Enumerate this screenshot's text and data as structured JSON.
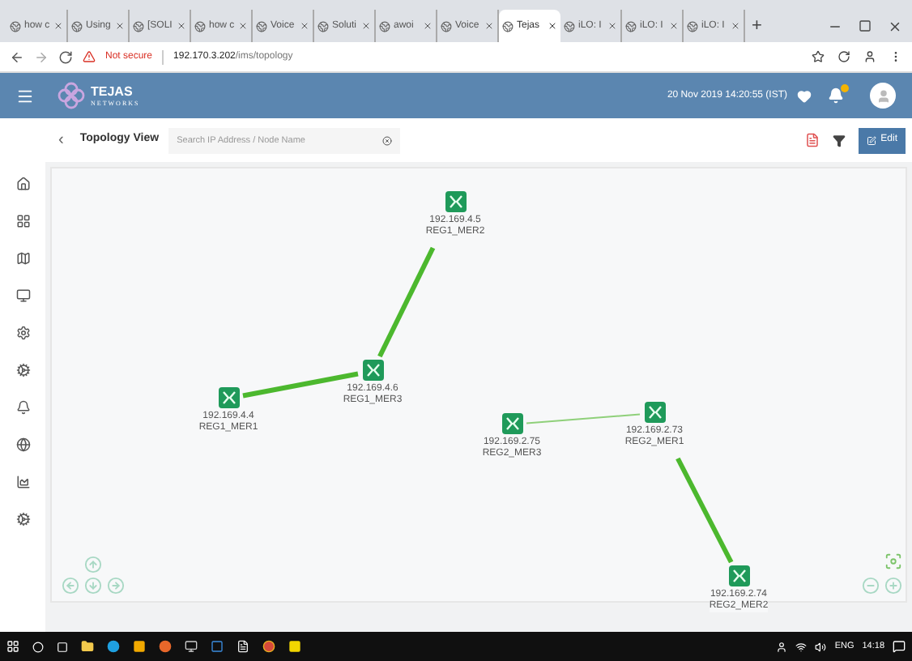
{
  "browser": {
    "tabs": [
      {
        "label": "how c",
        "selected": false
      },
      {
        "label": "Using",
        "selected": false
      },
      {
        "label": "[SOLI",
        "selected": false
      },
      {
        "label": "how c",
        "selected": false
      },
      {
        "label": "Voice",
        "selected": false
      },
      {
        "label": "Soluti",
        "selected": false
      },
      {
        "label": "awoi",
        "selected": false
      },
      {
        "label": "Voice",
        "selected": false
      },
      {
        "label": "Tejas",
        "selected": true
      },
      {
        "label": "iLO: I",
        "selected": false
      },
      {
        "label": "iLO: I",
        "selected": false
      },
      {
        "label": "iLO: I",
        "selected": false
      }
    ],
    "new_tab": "+",
    "security": "Not secure",
    "host": "192.170.3.202",
    "path": "/ims/topology"
  },
  "header": {
    "brand": "TEJAS",
    "brand_sub": "NETWORKS",
    "datetime": "20 Nov 2019 14:20:55 (IST)"
  },
  "toolbar": {
    "back": "‹",
    "title": "Topology View",
    "search": {
      "placeholder": "Search IP Address / Node Name"
    },
    "edit_button": "Edit"
  },
  "topology": {
    "nodes": [
      {
        "ip": "192.169.4.5",
        "name": "REG1_MER2"
      },
      {
        "ip": "192.169.4.6",
        "name": "REG1_MER3"
      },
      {
        "ip": "192.169.4.4",
        "name": "REG1_MER1"
      },
      {
        "ip": "192.169.2.75",
        "name": "REG2_MER3"
      },
      {
        "ip": "192.169.2.73",
        "name": "REG2_MER1"
      },
      {
        "ip": "192.169.2.74",
        "name": "REG2_MER2"
      }
    ],
    "links": [
      {
        "kind": "thick"
      },
      {
        "kind": "thick"
      },
      {
        "kind": "thin"
      },
      {
        "kind": "thick"
      }
    ]
  },
  "taskbar": {
    "language": "ENG",
    "time": "14:18"
  }
}
